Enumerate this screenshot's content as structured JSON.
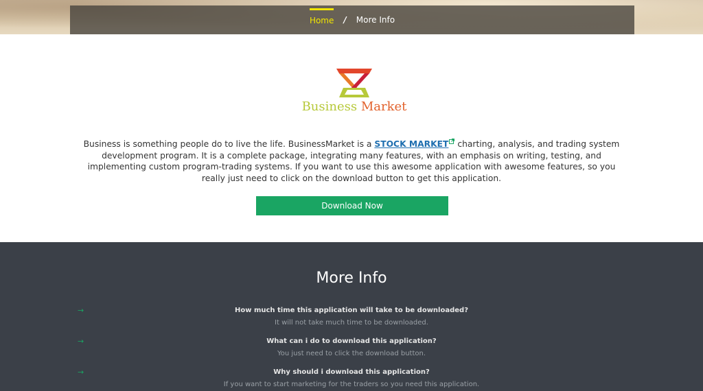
{
  "breadcrumb": {
    "home": "Home",
    "separator": "/",
    "current": "More Info"
  },
  "logo": {
    "word1": "Business",
    "word2": "Market",
    "colors": {
      "word1": "#b7c93a",
      "word2": "#e2612b"
    }
  },
  "description": {
    "before_link": "Business is something people do to live the life. BusinessMarket is a ",
    "link_text": "STOCK MARKET",
    "after_link": " charting, analysis, and trading system development program. It is a complete package, integrating many features, with an emphasis on writing, testing, and implementing custom program-trading systems. If you want to use this awesome application with awesome features, so you really just need to click on the download button to get this application."
  },
  "download_button": {
    "label": "Download Now",
    "color": "#1aa563"
  },
  "more_info": {
    "title": "More Info",
    "items": [
      {
        "question": "How much time this application will take to be downloaded?",
        "answer": "It will not take much time to be downloaded."
      },
      {
        "question": "What can i do to download this application?",
        "answer": "You just need to click the download button."
      },
      {
        "question": "Why should i download this application?",
        "answer": "If you want to start marketing for the traders so you need this application."
      }
    ]
  },
  "icons": {
    "faq_arrow": "arrow-right-icon",
    "external_link": "external-link-icon"
  }
}
